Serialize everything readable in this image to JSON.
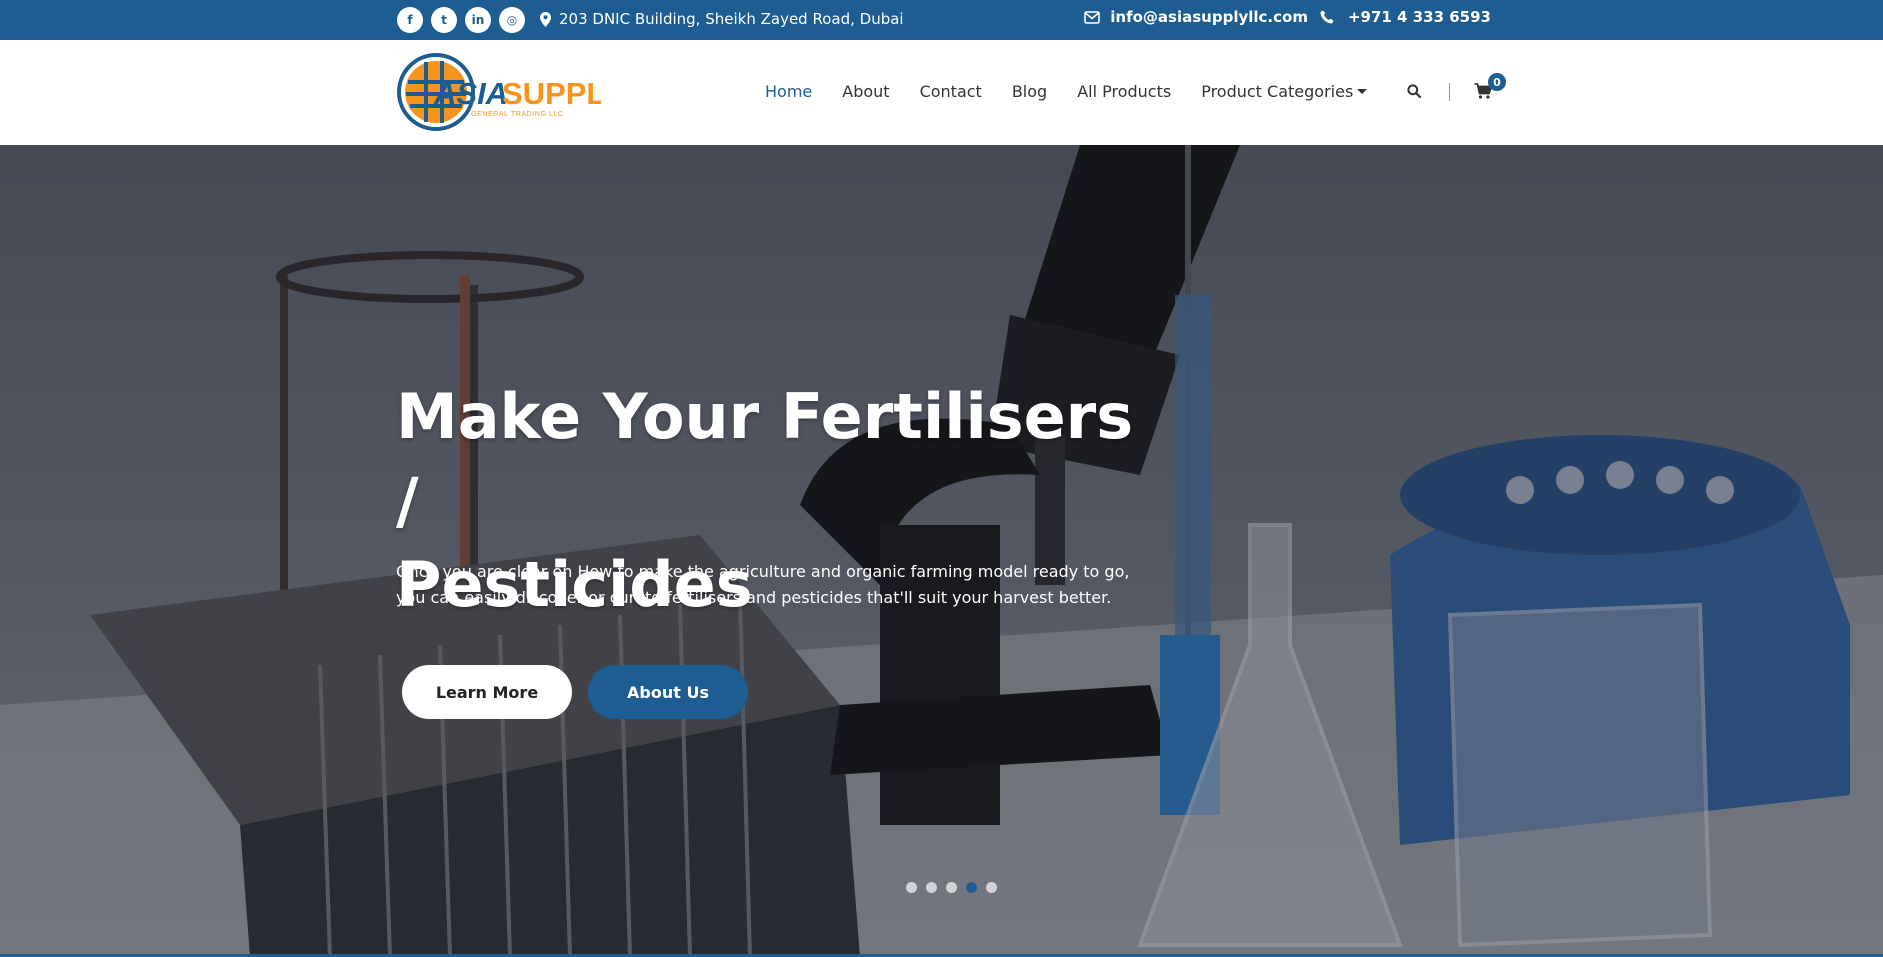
{
  "topbar": {
    "social": [
      {
        "icon": "facebook-icon",
        "glyph": "f"
      },
      {
        "icon": "twitter-icon",
        "glyph": "t"
      },
      {
        "icon": "linkedin-icon",
        "glyph": "in"
      },
      {
        "icon": "instagram-icon",
        "glyph": "◎"
      }
    ],
    "address": "203 DNIC Building, Sheikh Zayed Road, Dubai",
    "email": "info@asiasupplyllc.com",
    "phone": "+971 4 333 6593"
  },
  "brand": {
    "name_part1": "ASIA",
    "name_part2": "SUPPLY",
    "tagline": "GENERAL TRADING LLC",
    "colors": {
      "blue": "#1d5d91",
      "orange": "#f7941d"
    }
  },
  "nav": {
    "items": [
      "Home",
      "About",
      "Contact",
      "Blog",
      "All Products",
      "Product Categories"
    ],
    "active": "Home",
    "cart_count": "0"
  },
  "hero": {
    "title_line1": "Make Your Fertilisers /",
    "title_line2": "Pesticides",
    "text_line1": "Once you are clear on How to make the agriculture and organic farming model ready to go,",
    "text_line2": "you can easily discover or curate fertilisers and pesticides that'll suit your harvest better.",
    "learn_more": "Learn More",
    "about_us": "About Us",
    "slides_total": 5,
    "slide_active": 4
  }
}
